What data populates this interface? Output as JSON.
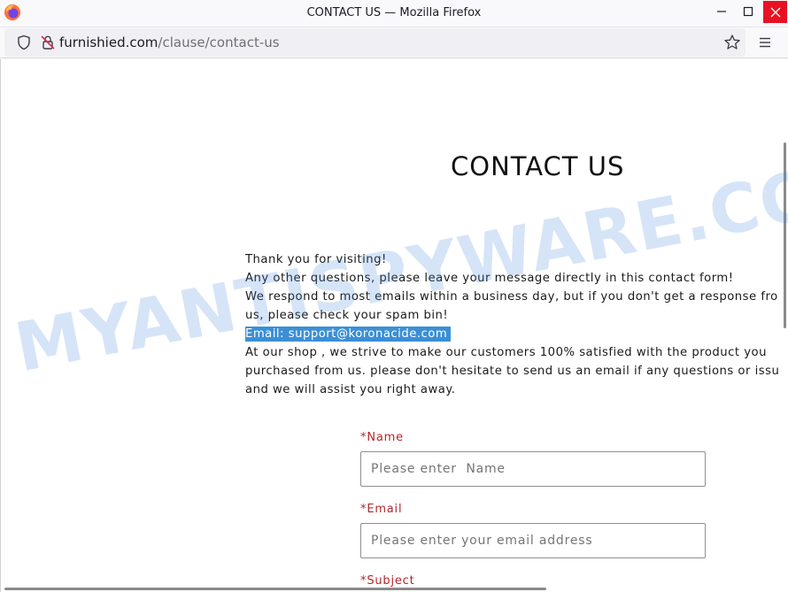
{
  "window": {
    "title": "CONTACT US — Mozilla Firefox"
  },
  "urlbar": {
    "domain": "furnishied.com",
    "path": "/clause/contact-us"
  },
  "page": {
    "heading": "CONTACT US",
    "lines": [
      "Thank you for visiting!",
      "Any other questions, please leave your message directly in this contact form!",
      "We respond to most emails within a business day, but if you don't get a response fro",
      "us, please check your spam bin!"
    ],
    "email_line": "Email: support@koronacide.com",
    "lines2": [
      "At our shop , we strive to make our customers 100% satisfied with the product you",
      "purchased from us. please don't hesitate to send us an email if any questions or issu",
      "and we will assist you right away."
    ]
  },
  "form": {
    "required_mark": "*",
    "name_label": "Name",
    "name_placeholder": "Please enter  Name",
    "email_label": "Email",
    "email_placeholder": "Please enter your email address",
    "subject_label": "Subject"
  },
  "watermark": "MYANTISPYWARE.COM",
  "colors": {
    "close_button": "#e81123",
    "label_red": "#b3272d",
    "selection": "#3b8fd6"
  }
}
